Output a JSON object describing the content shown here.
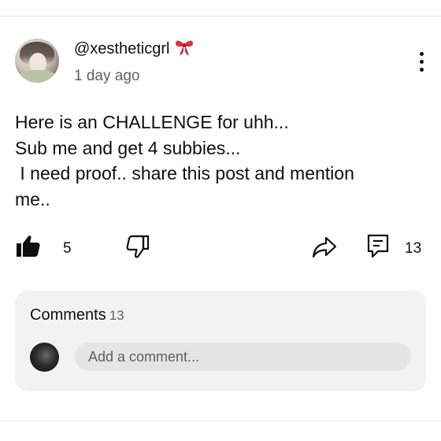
{
  "post": {
    "author": "@xestheticgrl",
    "author_emoji_icon": "ribbon-bow-icon",
    "timestamp": "1 day ago",
    "text_lines": [
      "Here is an CHALLENGE for uhh...",
      "Sub me and get 4 subbies...",
      " I need proof.. share this post and mention",
      "me.."
    ],
    "menu_icon": "three-dots-vertical-icon"
  },
  "actions": {
    "like_count": "5",
    "like_icon": "thumbs-up-filled-icon",
    "dislike_icon": "thumbs-down-outline-icon",
    "share_icon": "share-arrow-icon",
    "comment_icon": "comment-bubble-icon",
    "comment_count": "13"
  },
  "comments": {
    "title": "Comments",
    "count": "13",
    "input_placeholder": "Add a comment..."
  },
  "colors": {
    "text_primary": "#0f0f0f",
    "text_secondary": "#606060",
    "card_background": "#f2f2f2",
    "input_background": "#e5e5e5",
    "ribbon": "#e0303a"
  }
}
